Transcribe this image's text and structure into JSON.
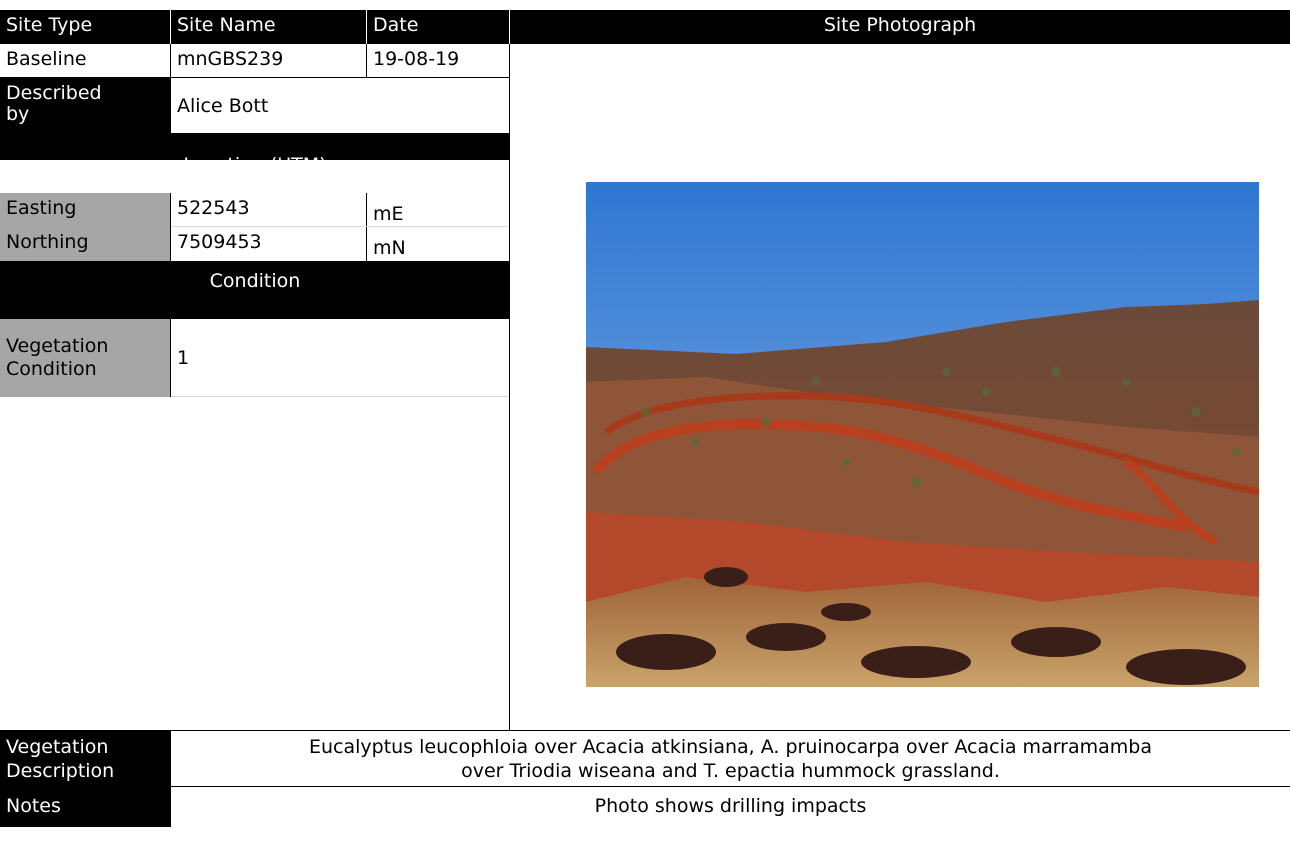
{
  "header": {
    "site_type": "Site Type",
    "site_name": "Site Name",
    "date": "Date",
    "site_photograph": "Site Photograph"
  },
  "site": {
    "site_type": "Baseline",
    "site_name": "mnGBS239",
    "date": "19-08-19"
  },
  "described_by": {
    "label_line1": "Described",
    "label_line2": "by",
    "value": "Alice Bott"
  },
  "location": {
    "heading": "Location (UTM)",
    "easting_label": "Easting",
    "easting_value": "522543",
    "easting_unit": "mE",
    "northing_label": "Northing",
    "northing_value": "7509453",
    "northing_unit": "mN"
  },
  "condition": {
    "heading": "Condition",
    "label_line1": "Vegetation",
    "label_line2": "Condition",
    "value": "1"
  },
  "vegetation_description": {
    "label_line1": "Vegetation",
    "label_line2": "Description",
    "line1": "Eucalyptus leucophloia over Acacia atkinsiana, A. pruinocarpa over Acacia marramamba",
    "line2": "over Triodia wiseana and T. epactia hummock grassland."
  },
  "notes": {
    "label": "Notes",
    "value": "Photo shows drilling impacts"
  },
  "colors": {
    "header_bg": "#000000",
    "label_bg": "#a6a6a6",
    "sky": "#3f86d6",
    "red_earth": "#9a3a1f"
  }
}
